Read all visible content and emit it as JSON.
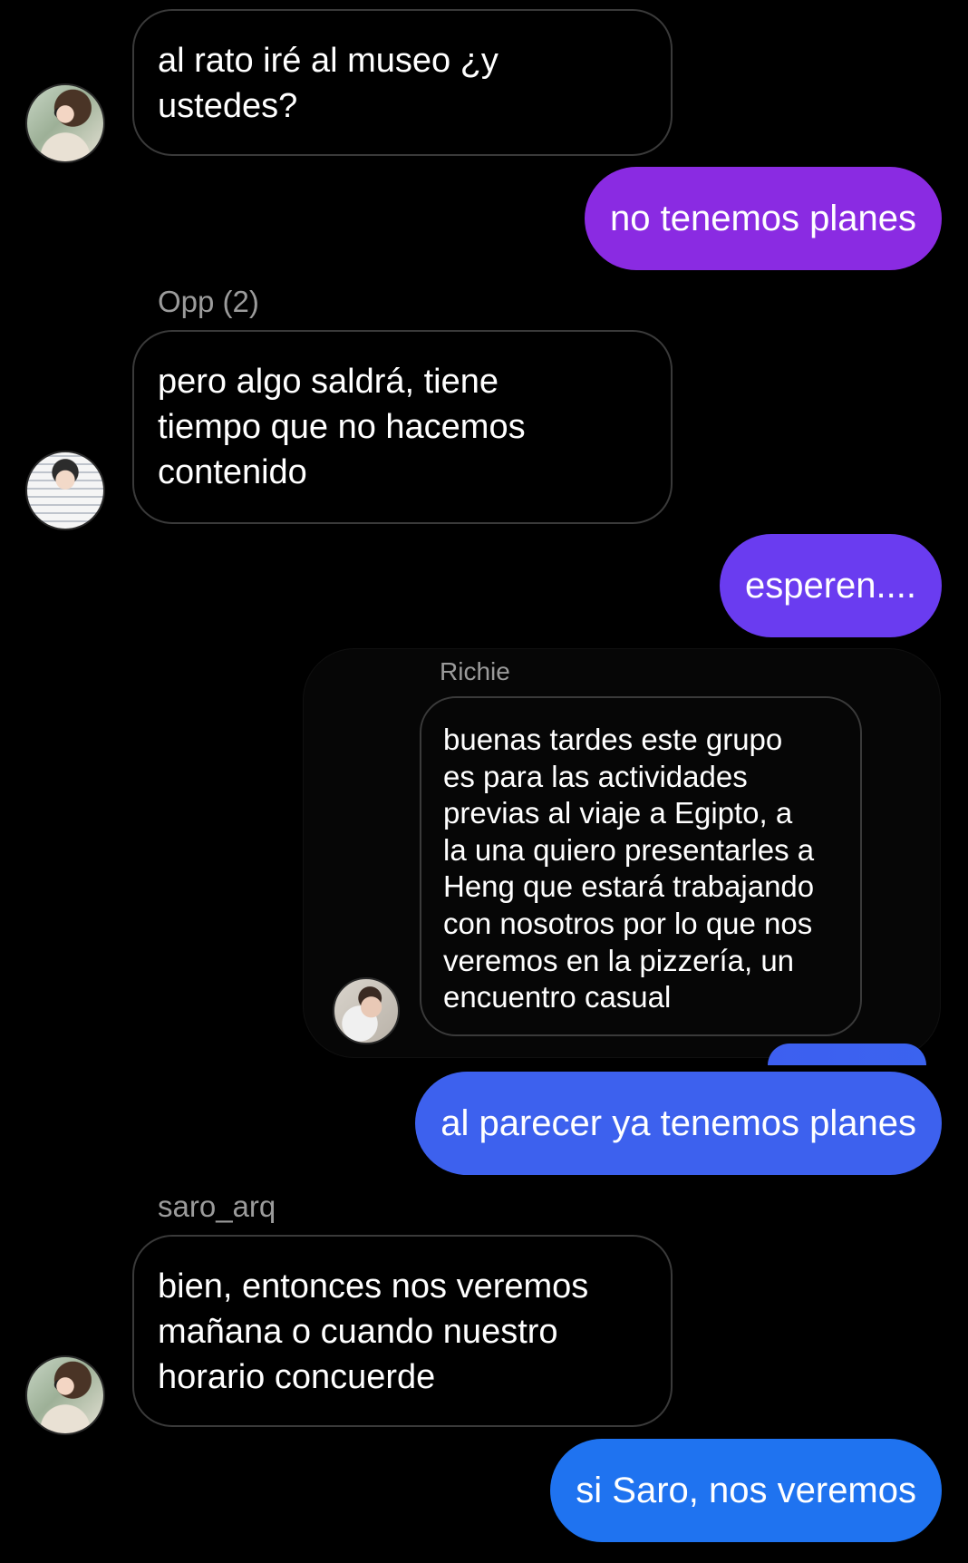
{
  "colors": {
    "background": "#000000",
    "incoming_border": "#3a3a3a",
    "sender_label": "#9b9b9b",
    "outgoing_purple": "#8a2be2",
    "outgoing_violet": "#6a3cf0",
    "outgoing_blue": "#3d61ee",
    "outgoing_azure": "#1f73f0"
  },
  "messages": [
    {
      "kind": "incoming",
      "sender": "",
      "avatar": "saro-avatar",
      "text": "al rato iré al museo ¿y\nustedes?"
    },
    {
      "kind": "outgoing",
      "text": "no tenemos planes"
    },
    {
      "kind": "incoming",
      "sender": "Opp (2)",
      "avatar": "opp-avatar",
      "text": "pero algo saldrá, tiene\ntiempo que no hacemos\ncontenido"
    },
    {
      "kind": "outgoing",
      "text": "esperen...."
    },
    {
      "kind": "forwarded",
      "sender": "Richie",
      "avatar": "richie-avatar",
      "text": "buenas tardes este grupo\nes para las actividades\nprevias al viaje a Egipto, a\nla una quiero presentarles a\nHeng que estará trabajando\ncon nosotros por lo que nos\nveremos en la pizzería, un\nencuentro casual"
    },
    {
      "kind": "outgoing",
      "text": "al parecer ya tenemos planes"
    },
    {
      "kind": "incoming",
      "sender": "saro_arq",
      "avatar": "saro-avatar",
      "text": "bien, entonces nos veremos\nmañana o cuando nuestro\nhorario concuerde"
    },
    {
      "kind": "outgoing",
      "text": "si Saro, nos veremos"
    }
  ]
}
